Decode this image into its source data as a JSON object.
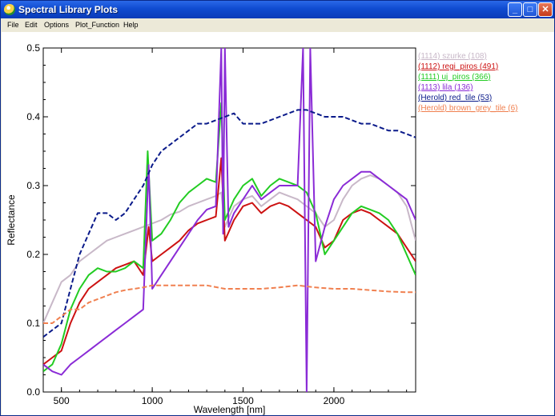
{
  "window": {
    "title": "Spectral Library Plots",
    "icon": "idl-app-icon",
    "buttons": {
      "minimize": "_",
      "maximize": "□",
      "close": "✕"
    }
  },
  "menu": [
    {
      "label": "File"
    },
    {
      "label": "Edit"
    },
    {
      "label": "Options"
    },
    {
      "label": "Plot_Function"
    },
    {
      "label": "Help"
    }
  ],
  "legend": [
    {
      "label": "(1114) szurke (108)",
      "color": "#c8b8c8"
    },
    {
      "label": "(1112) regi_piros (491)",
      "color": "#cc1111"
    },
    {
      "label": "(1111) uj_piros (366)",
      "color": "#22cc22"
    },
    {
      "label": "(1113) lila (136)",
      "color": "#8a2bd6"
    },
    {
      "label": "(Herold) red_tile (53)",
      "color": "#0a1a8a"
    },
    {
      "label": "(Herold) brown_grey_tile (6)",
      "color": "#f08050"
    }
  ],
  "chart_data": {
    "type": "line",
    "xlabel": "Wavelength [nm]",
    "ylabel": "Reflectance",
    "xlim": [
      400,
      2450
    ],
    "ylim": [
      0.0,
      0.5
    ],
    "xticks": [
      500,
      1000,
      1500,
      2000
    ],
    "yticks": [
      0.0,
      0.1,
      0.2,
      0.3,
      0.4,
      0.5
    ],
    "ytick_labels": [
      "0.0",
      "0.1",
      "0.2",
      "0.3",
      "0.4",
      "0.5"
    ],
    "grid": false,
    "legend_position": "right",
    "series": [
      {
        "name": "(1114) szurke (108)",
        "color": "#c8b8c8",
        "dash": "",
        "x": [
          400,
          450,
          500,
          550,
          600,
          650,
          700,
          750,
          800,
          850,
          900,
          950,
          1000,
          1050,
          1100,
          1150,
          1200,
          1250,
          1300,
          1350,
          1380,
          1400,
          1450,
          1500,
          1550,
          1600,
          1650,
          1700,
          1750,
          1800,
          1850,
          1900,
          1950,
          2000,
          2050,
          2100,
          2150,
          2200,
          2250,
          2300,
          2350,
          2400,
          2450
        ],
        "y": [
          0.1,
          0.13,
          0.16,
          0.17,
          0.19,
          0.2,
          0.21,
          0.22,
          0.225,
          0.23,
          0.235,
          0.24,
          0.245,
          0.25,
          0.258,
          0.262,
          0.27,
          0.275,
          0.28,
          0.285,
          0.29,
          0.24,
          0.27,
          0.28,
          0.285,
          0.27,
          0.28,
          0.29,
          0.285,
          0.28,
          0.27,
          0.26,
          0.24,
          0.25,
          0.28,
          0.3,
          0.31,
          0.315,
          0.31,
          0.3,
          0.29,
          0.27,
          0.22
        ]
      },
      {
        "name": "(1112) regi_piros (491)",
        "color": "#cc1111",
        "dash": "",
        "x": [
          400,
          450,
          500,
          550,
          600,
          650,
          700,
          750,
          800,
          850,
          900,
          950,
          980,
          1000,
          1050,
          1100,
          1150,
          1200,
          1250,
          1300,
          1350,
          1380,
          1400,
          1450,
          1500,
          1550,
          1600,
          1650,
          1700,
          1750,
          1800,
          1850,
          1900,
          1950,
          2000,
          2050,
          2100,
          2150,
          2200,
          2250,
          2300,
          2350,
          2400,
          2450
        ],
        "y": [
          0.04,
          0.05,
          0.06,
          0.1,
          0.13,
          0.15,
          0.16,
          0.17,
          0.18,
          0.185,
          0.19,
          0.17,
          0.24,
          0.19,
          0.2,
          0.21,
          0.22,
          0.235,
          0.245,
          0.25,
          0.255,
          0.34,
          0.22,
          0.25,
          0.27,
          0.275,
          0.26,
          0.27,
          0.275,
          0.27,
          0.26,
          0.25,
          0.24,
          0.21,
          0.22,
          0.25,
          0.26,
          0.265,
          0.26,
          0.25,
          0.24,
          0.23,
          0.21,
          0.19
        ]
      },
      {
        "name": "(1111) uj_piros (366)",
        "color": "#22cc22",
        "dash": "",
        "x": [
          400,
          450,
          500,
          550,
          600,
          650,
          700,
          750,
          800,
          850,
          900,
          950,
          975,
          1000,
          1050,
          1100,
          1150,
          1200,
          1250,
          1300,
          1350,
          1380,
          1400,
          1450,
          1500,
          1550,
          1600,
          1650,
          1700,
          1750,
          1800,
          1850,
          1900,
          1950,
          2000,
          2050,
          2100,
          2150,
          2200,
          2250,
          2300,
          2350,
          2400,
          2450
        ],
        "y": [
          0.03,
          0.04,
          0.07,
          0.12,
          0.15,
          0.17,
          0.18,
          0.175,
          0.175,
          0.18,
          0.19,
          0.18,
          0.35,
          0.22,
          0.23,
          0.25,
          0.275,
          0.29,
          0.3,
          0.31,
          0.305,
          0.42,
          0.25,
          0.28,
          0.3,
          0.31,
          0.285,
          0.3,
          0.31,
          0.305,
          0.3,
          0.29,
          0.26,
          0.2,
          0.22,
          0.24,
          0.26,
          0.27,
          0.265,
          0.26,
          0.25,
          0.23,
          0.2,
          0.17
        ]
      },
      {
        "name": "(1113) lila (136)",
        "color": "#8a2bd6",
        "dash": "",
        "x": [
          400,
          450,
          500,
          550,
          600,
          650,
          700,
          750,
          800,
          850,
          900,
          950,
          980,
          1000,
          1050,
          1100,
          1150,
          1200,
          1250,
          1300,
          1350,
          1380,
          1390,
          1400,
          1420,
          1450,
          1500,
          1550,
          1600,
          1650,
          1700,
          1750,
          1800,
          1830,
          1850,
          1870,
          1900,
          1950,
          2000,
          2050,
          2100,
          2150,
          2200,
          2250,
          2300,
          2350,
          2400,
          2450
        ],
        "y": [
          0.04,
          0.03,
          0.025,
          0.04,
          0.05,
          0.06,
          0.07,
          0.08,
          0.09,
          0.1,
          0.11,
          0.12,
          0.33,
          0.15,
          0.17,
          0.19,
          0.21,
          0.23,
          0.25,
          0.265,
          0.27,
          0.5,
          0.23,
          0.5,
          0.24,
          0.26,
          0.28,
          0.3,
          0.28,
          0.29,
          0.3,
          0.3,
          0.3,
          0.5,
          0.0,
          0.5,
          0.19,
          0.24,
          0.28,
          0.3,
          0.31,
          0.32,
          0.32,
          0.31,
          0.3,
          0.29,
          0.28,
          0.25
        ]
      },
      {
        "name": "(Herold) red_tile (53)",
        "color": "#0a1a8a",
        "dash": "6,3",
        "x": [
          400,
          450,
          500,
          550,
          600,
          650,
          700,
          750,
          800,
          850,
          900,
          950,
          1000,
          1050,
          1100,
          1150,
          1200,
          1250,
          1300,
          1350,
          1400,
          1450,
          1500,
          1550,
          1600,
          1650,
          1700,
          1750,
          1800,
          1850,
          1900,
          1950,
          2000,
          2050,
          2100,
          2150,
          2200,
          2250,
          2300,
          2350,
          2400,
          2450
        ],
        "y": [
          0.08,
          0.09,
          0.1,
          0.15,
          0.2,
          0.23,
          0.26,
          0.26,
          0.25,
          0.26,
          0.28,
          0.3,
          0.33,
          0.35,
          0.36,
          0.37,
          0.38,
          0.39,
          0.39,
          0.395,
          0.4,
          0.405,
          0.39,
          0.39,
          0.39,
          0.395,
          0.4,
          0.405,
          0.41,
          0.41,
          0.405,
          0.4,
          0.4,
          0.4,
          0.395,
          0.39,
          0.39,
          0.385,
          0.38,
          0.38,
          0.375,
          0.37
        ]
      },
      {
        "name": "(Herold) brown_grey_tile (6)",
        "color": "#f08050",
        "dash": "6,3",
        "x": [
          400,
          450,
          500,
          550,
          600,
          650,
          700,
          750,
          800,
          850,
          900,
          950,
          1000,
          1100,
          1200,
          1300,
          1400,
          1500,
          1600,
          1700,
          1800,
          1900,
          2000,
          2100,
          2200,
          2300,
          2400,
          2450
        ],
        "y": [
          0.1,
          0.1,
          0.11,
          0.12,
          0.12,
          0.13,
          0.135,
          0.14,
          0.145,
          0.148,
          0.15,
          0.152,
          0.155,
          0.155,
          0.155,
          0.155,
          0.15,
          0.15,
          0.15,
          0.152,
          0.155,
          0.152,
          0.15,
          0.15,
          0.148,
          0.146,
          0.145,
          0.145
        ]
      }
    ]
  }
}
